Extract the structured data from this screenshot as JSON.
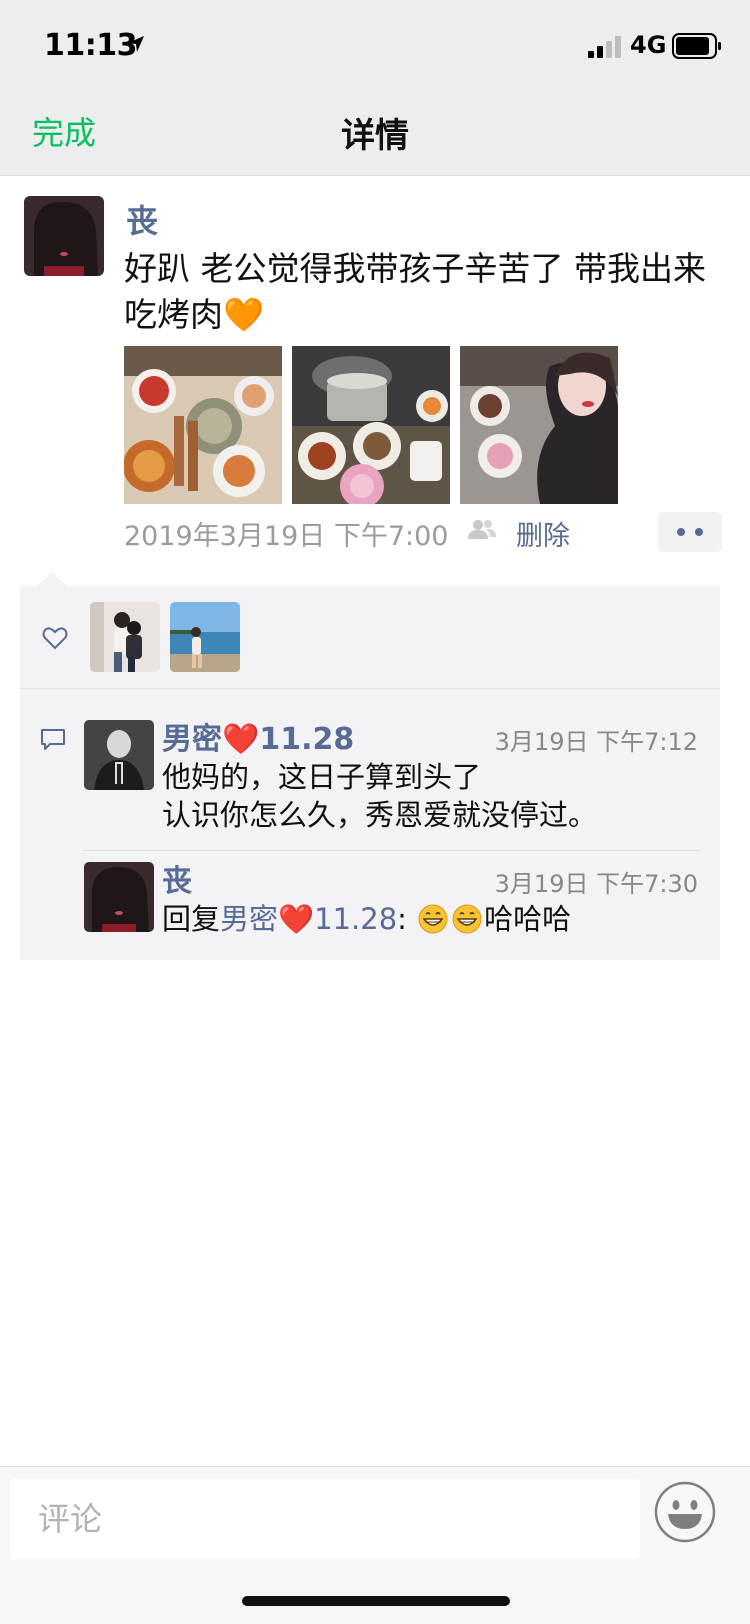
{
  "status_bar": {
    "time": "11:13",
    "network": "4G"
  },
  "nav": {
    "done_label": "完成",
    "title": "详情"
  },
  "post": {
    "author": "丧",
    "text": "好趴 老公觉得我带孩子辛苦了 带我出来吃烤肉🧡",
    "time": "2019年3月19日 下午7:00",
    "delete_label": "删除"
  },
  "comments": [
    {
      "author": "男密❤️11.28",
      "time": "3月19日 下午7:12",
      "text_line1": "他妈的，这日子算到头了",
      "text_line2": "认识你怎么久，秀恩爱就没停过。"
    },
    {
      "author": "丧",
      "time": "3月19日 下午7:30",
      "reply_prefix": "回复",
      "reply_to": "男密❤️11.28",
      "reply_colon": ":",
      "reply_text": "哈哈哈"
    }
  ],
  "input": {
    "placeholder": "评论"
  },
  "icons": {
    "location": "location-arrow-icon",
    "signal": "signal-icon",
    "battery": "battery-icon",
    "visibility": "friends-visibility-icon",
    "like": "heart-outline-icon",
    "comment": "comment-bubble-icon",
    "emoji": "smiley-icon"
  },
  "colors": {
    "accent_green": "#07c160",
    "link_blue": "#576b95",
    "nav_bg": "#ededed"
  }
}
